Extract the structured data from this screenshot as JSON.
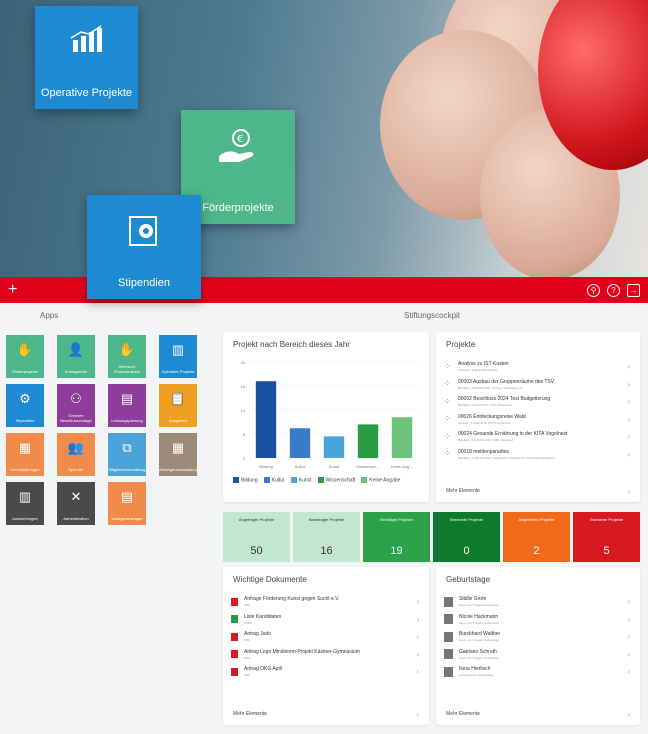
{
  "tiles": {
    "operative": "Operative Projekte",
    "foerder": "Förderprojekte",
    "stipendien": "Stipendien"
  },
  "header": {
    "apps_title": "Apps",
    "cockpit_title": "Stiftungscockpit"
  },
  "apps": [
    {
      "label": "Förderprojekte",
      "color": "#4db68b",
      "icon": "hand-coin-icon"
    },
    {
      "label": "Antragsteller",
      "color": "#4db68b",
      "icon": "person-icon"
    },
    {
      "label": "Übersicht Förderprojekte",
      "color": "#4db68b",
      "icon": "hand-coin-icon"
    },
    {
      "label": "Operative Projekte",
      "color": "#1d8ad2",
      "icon": "chart-icon"
    },
    {
      "label": "Stipendien",
      "color": "#1d8ad2",
      "icon": "gear-icon"
    },
    {
      "label": "Gremien Beschlussvorlage",
      "color": "#8e3d9c",
      "icon": "group-icon"
    },
    {
      "label": "Leistungsplanung",
      "color": "#8e3d9c",
      "icon": "money-icon"
    },
    {
      "label": "Ausgaben",
      "color": "#f0a020",
      "icon": "clipboard-icon"
    },
    {
      "label": "Veranstaltungen",
      "color": "#f08b4c",
      "icon": "calendar-icon"
    },
    {
      "label": "Spender",
      "color": "#f08b4c",
      "icon": "people-icon"
    },
    {
      "label": "Mitgliederverwaltung",
      "color": "#4aa4d8",
      "icon": "network-icon"
    },
    {
      "label": "Vermögensverwaltung",
      "color": "#9b8b78",
      "icon": "grid-icon"
    },
    {
      "label": "Auswertungen",
      "color": "#4a4a4a",
      "icon": "building-icon"
    },
    {
      "label": "Administration",
      "color": "#4a4a4a",
      "icon": "tools-icon"
    },
    {
      "label": "Vorlagenmanager",
      "color": "#f08b4c",
      "icon": "document-icon"
    }
  ],
  "chart_data": {
    "type": "bar",
    "title": "Projekt nach Bereich dieses Jahr",
    "categories": [
      "Bildung",
      "Kultur",
      "Kunst",
      "Wissenschaft",
      "Keine Angabe"
    ],
    "values": [
      16,
      6.2,
      4.5,
      7,
      8.5
    ],
    "colors": [
      "#1b4fa0",
      "#3a7bc8",
      "#4aa4d8",
      "#2a9c45",
      "#6dc27a"
    ],
    "ylim": [
      0,
      20
    ],
    "yticks": [
      0,
      5,
      10,
      15,
      20
    ]
  },
  "projects": {
    "title": "Projekte",
    "items": [
      {
        "name": "Analyse zu IST-Kosten",
        "sub": "Operative Projekt Beschlüsse"
      },
      {
        "name": "00003 Ausbau der Gruppenräume des TSV",
        "sub": "Bewilligt | 1.5.2020 EUR | Antrag: Schneider u.a."
      },
      {
        "name": "00002 Beschluss 2024 Test Budgetierung",
        "sub": "Bewilligt | 1.2022 EUR | CK2 Schwab AG"
      },
      {
        "name": "00026 Entdeckungsreise Wald",
        "sub": "Gestellt | 1.2023 EUR | KITA Vogelnest"
      },
      {
        "name": "00024 Gesunde Ernährung in der KITA Vogelnest",
        "sub": "Bewilligt | 1.4.2023 EUR | KITA Vogelnest"
      },
      {
        "name": "00018 meldenparadies",
        "sub": "Bewilligt | 1.446.46 EUR | Gladbacher Gymnasium Immobilienverwaltung"
      }
    ],
    "more": "Mehr Elemente"
  },
  "stats": [
    {
      "label": "Angefragte Projekte",
      "value": "50",
      "bg": "#c3e6cf",
      "fg": "#333"
    },
    {
      "label": "Beantragte Projekte",
      "value": "16",
      "bg": "#c3e6cf",
      "fg": "#333"
    },
    {
      "label": "Bewilligte Projekte",
      "value": "19",
      "bg": "#2ba14a",
      "fg": "#fff"
    },
    {
      "label": "Beendete Projekte",
      "value": "0",
      "bg": "#0d7a2c",
      "fg": "#fff"
    },
    {
      "label": "Abgelehnte Projekte",
      "value": "2",
      "bg": "#f06a1a",
      "fg": "#fff"
    },
    {
      "label": "Stornierte Projekte",
      "value": "5",
      "bg": "#d71920",
      "fg": "#fff"
    }
  ],
  "documents": {
    "title": "Wichtige Dokumente",
    "items": [
      {
        "name": "Anfrage Förderung Kunst gegen Sucht e.V.",
        "sub": "PDF",
        "icon_color": "#d71920"
      },
      {
        "name": "Liste Kandidaten",
        "sub": "XLSX",
        "icon_color": "#2a9c45"
      },
      {
        "name": "Antrag Judo",
        "sub": "PDF",
        "icon_color": "#d71920"
      },
      {
        "name": "Antrag Lego Mindstorm Projekt Kästner-Gymnasium",
        "sub": "PDF",
        "icon_color": "#d71920"
      },
      {
        "name": "Antrag OKG April",
        "sub": "PDF",
        "icon_color": "#d71920"
      }
    ],
    "more": "Mehr Elemente"
  },
  "birthdays": {
    "title": "Geburtstage",
    "items": [
      {
        "name": "Sibille Grote",
        "sub": "heute vor 2 Tagen Geburtstag"
      },
      {
        "name": "Nicole Hackmann",
        "sub": "heute vor 2 Tagen Geburtstag"
      },
      {
        "name": "Burckhard Walther",
        "sub": "heute vor 3 Tagen Geburtstag"
      },
      {
        "name": "Gaetano Schroth",
        "sub": "heute vor 3 Tagen Geburtstag"
      },
      {
        "name": "Ilona Hierlisch",
        "sub": "heute gestern Geburtstag"
      }
    ],
    "more": "Mehr Elemente"
  }
}
